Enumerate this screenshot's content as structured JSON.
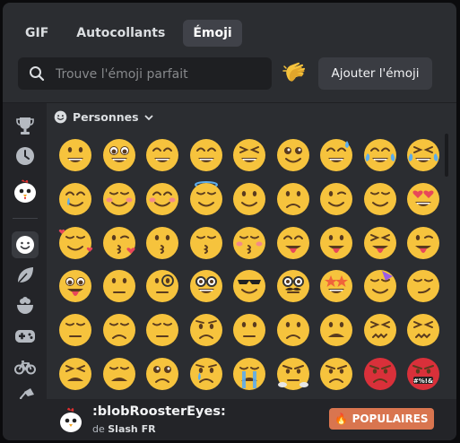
{
  "tabs": [
    {
      "label": "GIF",
      "active": false
    },
    {
      "label": "Autocollants",
      "active": false
    },
    {
      "label": "Émoji",
      "active": true
    }
  ],
  "search": {
    "placeholder": "Trouve l'émoji parfait",
    "value": ""
  },
  "add_button_label": "Ajouter l'émoji",
  "random_emoji_icon": "clapping-hands-icon",
  "sidebar": {
    "items": [
      {
        "icon": "trophy-icon",
        "selected": false
      },
      {
        "icon": "clock-recent-icon",
        "selected": false
      },
      {
        "icon": "rooster-server-icon",
        "selected": false
      },
      {
        "icon": "smiley-people-icon",
        "selected": true
      },
      {
        "icon": "leaf-nature-icon",
        "selected": false
      },
      {
        "icon": "food-bowl-icon",
        "selected": false
      },
      {
        "icon": "gamepad-activities-icon",
        "selected": false
      },
      {
        "icon": "bicycle-travel-icon",
        "selected": false
      },
      {
        "icon": "lamp-objects-icon",
        "selected": false
      },
      {
        "icon": "heart-symbols-icon",
        "selected": false
      }
    ]
  },
  "category": {
    "label": "Personnes",
    "icon": "smiley-icon"
  },
  "emoji_grid": [
    [
      "😀",
      "😃",
      "😄",
      "😁",
      "😆",
      "🥹",
      "😅",
      "😂",
      "🤣"
    ],
    [
      "🥲",
      "☺️",
      "😊",
      "😇",
      "🙂",
      "🙃",
      "😉",
      "😌",
      "😍"
    ],
    [
      "🥰",
      "😘",
      "😗",
      "😙",
      "😚",
      "😋",
      "😛",
      "😝",
      "😜"
    ],
    [
      "🤪",
      "🤨",
      "🧐",
      "🤓",
      "😎",
      "🥸",
      "🤩",
      "🥳",
      "😏"
    ],
    [
      "😒",
      "😞",
      "😔",
      "😟",
      "😕",
      "🙁",
      "☹️",
      "😣",
      "😖"
    ],
    [
      "😫",
      "😩",
      "🥺",
      "😢",
      "😭",
      "😤",
      "😠",
      "😡",
      "🤬"
    ]
  ],
  "footer": {
    "emoji_name": ":blobRoosterEyes:",
    "server_prefix": "de",
    "server_name": "Slash FR",
    "popular_label": "POPULAIRES"
  },
  "colors": {
    "panel": "#2b2d31",
    "sidebar": "#232428",
    "accent": "#d9754f",
    "emoji_yellow": "#f6c33d"
  }
}
